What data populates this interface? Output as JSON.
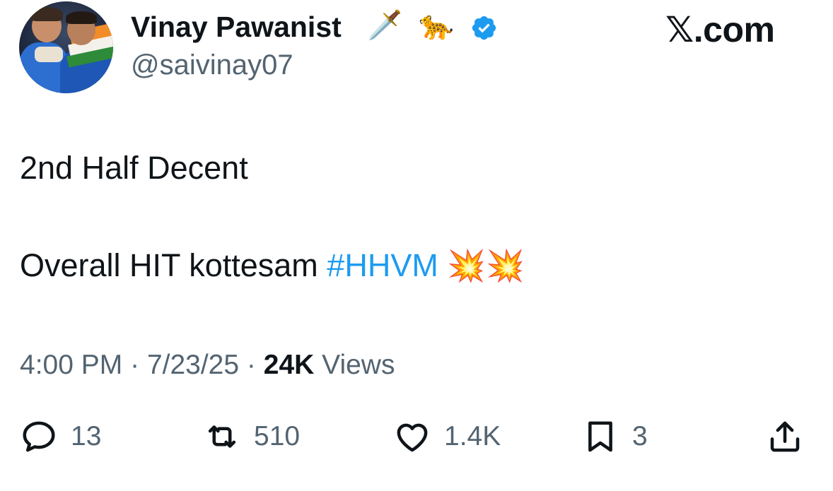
{
  "header": {
    "display_name": "Vinay Pawanist",
    "name_emojis": [
      "🗡️",
      "🐆"
    ],
    "handle": "@saivinay07",
    "site_label": "𝕏.com"
  },
  "tweet": {
    "line1": "2nd Half Decent",
    "line2_text": "Overall HIT kottesam ",
    "line2_hashtag": "#HHVM",
    "line2_emojis": "💥💥"
  },
  "meta": {
    "time": "4:00 PM",
    "date": "7/23/25",
    "separator": "·",
    "views_count": "24K",
    "views_label": "Views"
  },
  "actions": {
    "replies": "13",
    "reposts": "510",
    "likes": "1.4K",
    "bookmarks": "3"
  },
  "colors": {
    "text": "#0f1419",
    "secondary": "#536471",
    "accent": "#1d9bf0"
  }
}
